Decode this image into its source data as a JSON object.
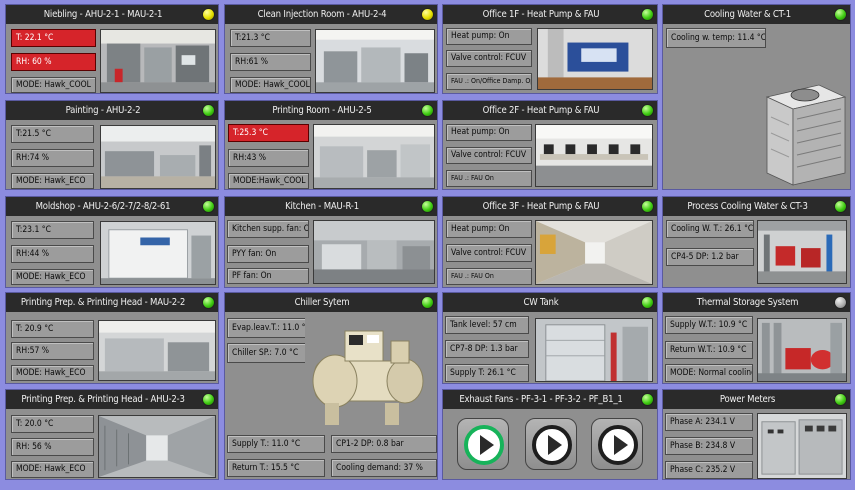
{
  "panels": {
    "niebling": {
      "title": "Niebling - AHU-2-1 - MAU-2-1",
      "led": "yellow",
      "temp": "T: 22.1 °C",
      "rh": "RH: 60 %",
      "mode": "MODE: Hawk_COOL"
    },
    "clean_injection": {
      "title": "Clean Injection Room - AHU-2-4",
      "led": "yellow",
      "temp": "T:21.3 °C",
      "rh": "RH:61 %",
      "mode": "MODE: Hawk_COOL"
    },
    "office1f": {
      "title": "Office 1F - Heat Pump & FAU",
      "led": "green",
      "pump": "Heat pump: On",
      "valve": "Valve control: FCUV",
      "fau": "FAU .: On/Office Damp. Op."
    },
    "cooling_water": {
      "title": "Cooling Water & CT-1",
      "led": "green",
      "temp": "Cooling w. temp: 11.4 °C"
    },
    "painting": {
      "title": "Painting - AHU-2-2",
      "led": "green",
      "temp": "T:21.5 °C",
      "rh": "RH:74 %",
      "mode": "MODE: Hawk_ECO"
    },
    "printing_room": {
      "title": "Printing Room - AHU-2-5",
      "led": "green",
      "temp": "T:25.3 °C",
      "rh": "RH:43 %",
      "mode": "MODE:Hawk_COOL"
    },
    "office2f": {
      "title": "Office 2F - Heat Pump & FAU",
      "led": "green",
      "pump": "Heat pump: On",
      "valve": "Valve control: FCUV",
      "fau": "FAU .: FAU On"
    },
    "moldshop": {
      "title": "Moldshop - AHU-2-6/2-7/2-8/2-61",
      "led": "green",
      "temp": "T:23.1 °C",
      "rh": "RH:44 %",
      "mode": "MODE: Hawk_ECO"
    },
    "kitchen": {
      "title": "Kitchen - MAU-R-1",
      "led": "green",
      "supply_fan": "Kitchen supp. fan: Off",
      "pyy_fan": "PYY fan: On",
      "pf_fan": "PF fan: On"
    },
    "office3f": {
      "title": "Office 3F - Heat Pump & FAU",
      "led": "green",
      "pump": "Heat pump: On",
      "valve": "Valve control: FCUV",
      "fau": "FAU .: FAU On"
    },
    "process_cooling": {
      "title": "Process Cooling Water & CT-3",
      "led": "green",
      "temp": "Cooling W. T.: 26.1 °C",
      "dp": "CP4-5 DP: 1.2 bar"
    },
    "printing_prep_mau": {
      "title": "Printing Prep. & Printing Head - MAU-2-2",
      "led": "green",
      "temp": "T: 20.9 °C",
      "rh": "RH:57 %",
      "mode": "MODE: Hawk_ECO"
    },
    "chiller": {
      "title": "Chiller Sytem",
      "led": "green",
      "evap": "Evap.leav.T.: 11.0 °C",
      "sp": "Chiller SP.: 7.0 °C",
      "supply": "Supply T.: 11.0 °C",
      "return": "Return T.: 15.5 °C",
      "cp_dp": "CP1-2 DP: 0.8 bar",
      "demand": "Cooling demand: 37 %"
    },
    "cw_tank": {
      "title": "CW Tank",
      "led": "green",
      "level": "Tank level: 57 cm",
      "dp": "CP7-8 DP: 1.3 bar",
      "supply": "Supply  T: 26.1 °C"
    },
    "thermal_storage": {
      "title": "Thermal Storage System",
      "led": "gray",
      "supply": "Supply W.T.: 10.9 °C",
      "return": "Return W.T.: 10.9 °C",
      "mode": "MODE: Normal cooling"
    },
    "printing_prep_ahu": {
      "title": "Printing Prep. & Printing Head - AHU-2-3",
      "led": "green",
      "temp": "T: 20.0 °C",
      "rh": "RH: 56 %",
      "mode": "MODE: Hawk_ECO"
    },
    "exhaust_fans": {
      "title": "Exhaust Fans - PF-3-1 - PF-3-2 - PF_B1_1",
      "led": "green"
    },
    "power_meters": {
      "title": "Power Meters",
      "led": "green",
      "phase_a": "Phase A: 234.1 V",
      "phase_b": "Phase B: 234.8 V",
      "phase_c": "Phase C: 235.2 V"
    }
  },
  "colors": {
    "alarm": "#d6242a",
    "led_ok": "#3fcc12",
    "led_warn": "#e6e000",
    "background": "#8c8ce0"
  }
}
